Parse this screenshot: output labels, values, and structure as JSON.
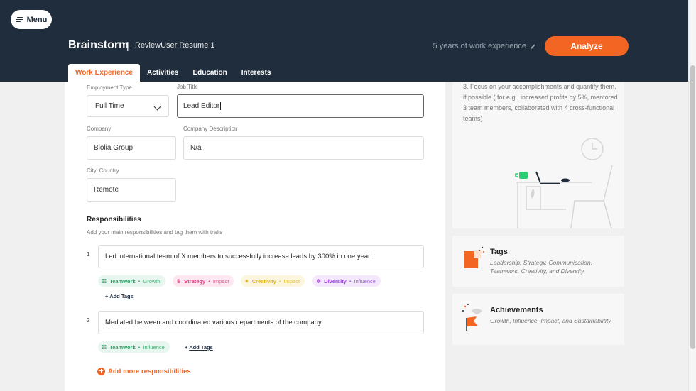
{
  "header": {
    "menu_label": "Menu",
    "brand": "Brainstorm",
    "separator": "|",
    "resume_name": "ReviewUser Resume 1",
    "experience_years": "5 years of work experience",
    "analyze_label": "Analyze"
  },
  "tabs": [
    {
      "label": "Work Experience",
      "active": true
    },
    {
      "label": "Activities",
      "active": false
    },
    {
      "label": "Education",
      "active": false
    },
    {
      "label": "Interests",
      "active": false
    }
  ],
  "form": {
    "employment_type": {
      "label": "Employment Type",
      "value": "Full Time"
    },
    "job_title": {
      "label": "Job Title",
      "value": "Lead Editor"
    },
    "company": {
      "label": "Company",
      "value": "Biolia Group"
    },
    "company_description": {
      "label": "Company Description",
      "value": "N/a"
    },
    "city_country": {
      "label": "City, Country",
      "value": "Remote"
    }
  },
  "responsibilities": {
    "title": "Responsibilities",
    "subtitle": "Add your main responsibilities and tag them with traits",
    "items": [
      {
        "number": "1",
        "text": "Led international team of X members to successfully increase leads by 300% in one year.",
        "tags": [
          {
            "name": "Teamwork",
            "category": "Growth",
            "color": "green"
          },
          {
            "name": "Strategy",
            "category": "Impact",
            "color": "pink"
          },
          {
            "name": "Creativity",
            "category": "Impact",
            "color": "yellow"
          },
          {
            "name": "Diversity",
            "category": "Influence",
            "color": "purple"
          }
        ],
        "add_tags_label": "Add Tags"
      },
      {
        "number": "2",
        "text": "Mediated between and coordinated various departments of the company.",
        "tags": [
          {
            "name": "Teamwork",
            "category": "Influence",
            "color": "green"
          }
        ],
        "add_tags_label": "Add Tags"
      }
    ],
    "add_more_label": "Add more responsibilities"
  },
  "sidebar": {
    "tip": "3. Focus on your accomplishments and quantify them, if possible ( for e.g., increased profits by 5%, mentored 3 team members, collaborated with 4 cross-functional teams)",
    "tags_card": {
      "title": "Tags",
      "description": "Leadership, Strategy, Communication, Teamwork, Creativity, and Diversity"
    },
    "achievements_card": {
      "title": "Achievements",
      "description": "Growth, Influence, Impact, and Sustainablitity"
    }
  },
  "colors": {
    "header_bg": "#1f2d3d",
    "accent": "#f26522",
    "green": "#2e9e63",
    "pink": "#d83b7f",
    "yellow": "#e3b422",
    "purple": "#9b40d8"
  }
}
